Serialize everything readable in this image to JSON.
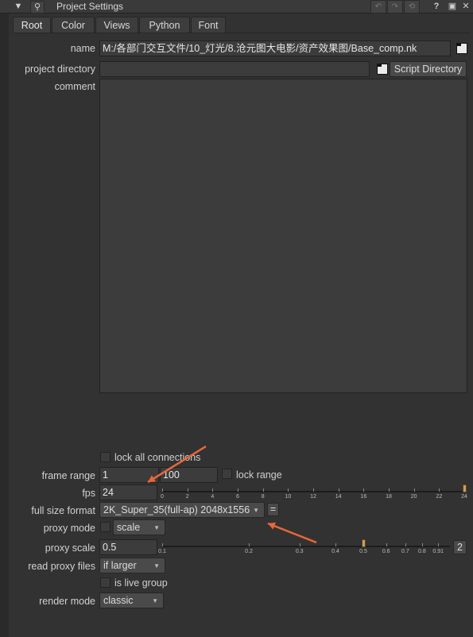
{
  "window": {
    "title": "Project Settings"
  },
  "tabs": [
    "Root",
    "Color",
    "Views",
    "Python",
    "Font"
  ],
  "active_tab": "Root",
  "fields": {
    "name": {
      "label": "name",
      "value": "M:/各部门交互文件/10_灯光/8.沧元图大电影/资产效果图/Base_comp.nk"
    },
    "project_directory": {
      "label": "project directory",
      "value": "",
      "button": "Script Directory"
    },
    "comment": {
      "label": "comment",
      "value": ""
    },
    "lock_all_connections": {
      "label": "lock all connections",
      "checked": false
    },
    "frame_range": {
      "label": "frame range",
      "first": "1",
      "last": "100",
      "lock_label": "lock range",
      "lock_checked": false
    },
    "fps": {
      "label": "fps",
      "value": "24",
      "slider_value": 24,
      "slider_ticks": [
        "0",
        "2",
        "4",
        "6",
        "8",
        "10",
        "12",
        "14",
        "16",
        "18",
        "20",
        "22",
        "24"
      ]
    },
    "full_size_format": {
      "label": "full size format",
      "value": "2K_Super_35(full-ap) 2048x1556",
      "edit_button": "="
    },
    "proxy_mode": {
      "label": "proxy mode",
      "checked": false,
      "value": "scale"
    },
    "proxy_scale": {
      "label": "proxy scale",
      "value": "0.5",
      "slider_value": 0.5,
      "slider_ticks": [
        "0.1",
        "0.2",
        "0.3",
        "0.4",
        "0.5",
        "0.6",
        "0.7",
        "0.8",
        "0.91"
      ],
      "button": "2"
    },
    "read_proxy_files": {
      "label": "read proxy files",
      "value": "if larger"
    },
    "is_live_group": {
      "label": "is live group",
      "checked": false
    },
    "render_mode": {
      "label": "render mode",
      "value": "classic"
    }
  },
  "annotation_color": "#e8673a",
  "icons": {
    "collapse": "triangle-down-icon",
    "pin": "pin-icon",
    "help": "?",
    "float": "float-window-icon",
    "close": "close-icon",
    "folder": "folder-icon"
  }
}
